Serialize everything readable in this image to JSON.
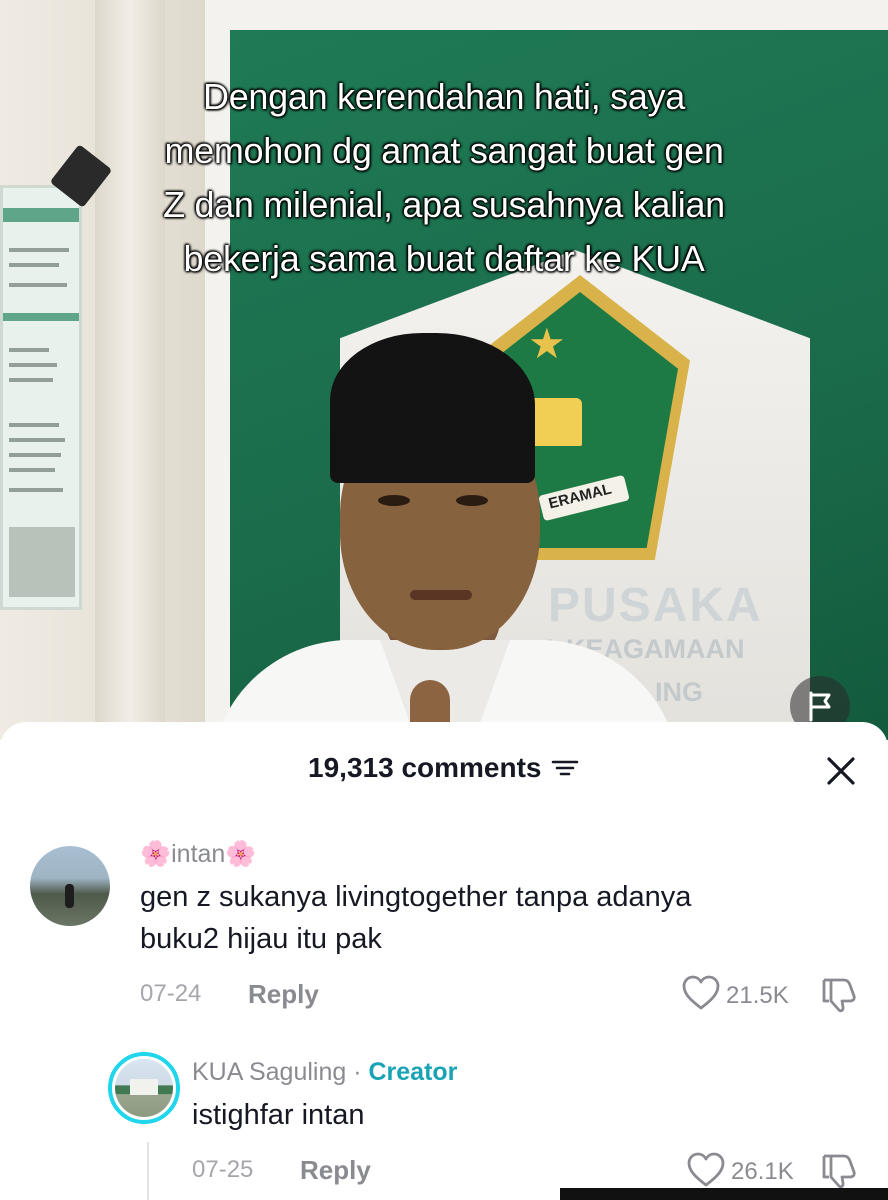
{
  "video": {
    "caption_lines": [
      "Dengan kerendahan hati, saya",
      "memohon dg amat sangat buat gen",
      "Z dan milenial, apa susahnya kalian",
      "bekerja sama buat daftar ke KUA"
    ],
    "sign_text": "PUSAKA",
    "sign_text_2": "A KEAGAMAAN",
    "sign_text_3": "ING",
    "emblem_text": "ERAMAL"
  },
  "comments_header": {
    "count_label": "19,313 comments"
  },
  "comments": [
    {
      "username": "🌸intan🌸",
      "text_lines": [
        "gen z sukanya livingtogether tanpa adanya",
        "buku2 hijau itu pak"
      ],
      "date": "07-24",
      "reply_label": "Reply",
      "likes": "21.5K"
    },
    {
      "username": "KUA Saguling",
      "separator": " · ",
      "badge": "Creator",
      "text": "istighfar intan",
      "date": "07-25",
      "reply_label": "Reply",
      "likes": "26.1K"
    }
  ],
  "icons": {
    "report": "flag-icon",
    "sort": "sort-icon",
    "close": "close-icon",
    "like": "heart-icon",
    "dislike": "thumbs-down-icon"
  },
  "colors": {
    "creator_badge": "#1aa3b4",
    "avatar_ring": "#20d5ec",
    "text_primary": "#161823",
    "text_secondary": "#8a8b91"
  }
}
